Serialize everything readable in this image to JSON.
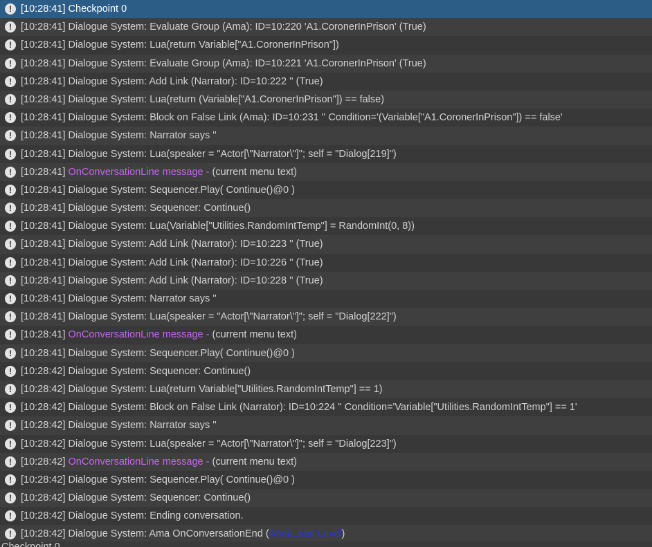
{
  "console": {
    "entries": [
      {
        "time": "[10:28:41]",
        "text": "Checkpoint 0",
        "selected": true
      },
      {
        "time": "[10:28:41]",
        "text": "Dialogue System: Evaluate Group (Ama): ID=10:220 'A1.CoronerInPrison' (True)"
      },
      {
        "time": "[10:28:41]",
        "text": "Dialogue System: Lua(return Variable[\"A1.CoronerInPrison\"])"
      },
      {
        "time": "[10:28:41]",
        "text": "Dialogue System: Evaluate Group (Ama): ID=10:221 'A1.CoronerInPrison' (True)"
      },
      {
        "time": "[10:28:41]",
        "text": "Dialogue System: Add Link (Narrator): ID=10:222 '' (True)"
      },
      {
        "time": "[10:28:41]",
        "text": "Dialogue System: Lua(return (Variable[\"A1.CoronerInPrison\"]) == false)"
      },
      {
        "time": "[10:28:41]",
        "text": "Dialogue System: Block on False Link (Ama): ID=10:231 '' Condition='(Variable[\"A1.CoronerInPrison\"]) == false'"
      },
      {
        "time": "[10:28:41]",
        "text": "Dialogue System: Narrator says ''"
      },
      {
        "time": "[10:28:41]",
        "text": "Dialogue System: Lua(speaker = \"Actor[\\\"Narrator\\\"]\"; self = \"Dialog[219]\")"
      },
      {
        "time": "[10:28:41]",
        "highlight": "OnConversationLine message - ",
        "text": " (current menu text)"
      },
      {
        "time": "[10:28:41]",
        "text": "Dialogue System: Sequencer.Play( Continue()@0 )"
      },
      {
        "time": "[10:28:41]",
        "text": "Dialogue System: Sequencer: Continue()"
      },
      {
        "time": "[10:28:41]",
        "text": "Dialogue System: Lua(Variable[\"Utilities.RandomIntTemp\"] = RandomInt(0, 8))"
      },
      {
        "time": "[10:28:41]",
        "text": "Dialogue System: Add Link (Narrator): ID=10:223 '' (True)"
      },
      {
        "time": "[10:28:41]",
        "text": "Dialogue System: Add Link (Narrator): ID=10:226 '' (True)"
      },
      {
        "time": "[10:28:41]",
        "text": "Dialogue System: Add Link (Narrator): ID=10:228 '' (True)"
      },
      {
        "time": "[10:28:41]",
        "text": "Dialogue System: Narrator says ''"
      },
      {
        "time": "[10:28:41]",
        "text": "Dialogue System: Lua(speaker = \"Actor[\\\"Narrator\\\"]\"; self = \"Dialog[222]\")"
      },
      {
        "time": "[10:28:41]",
        "highlight": "OnConversationLine message - ",
        "text": " (current menu text)"
      },
      {
        "time": "[10:28:41]",
        "text": "Dialogue System: Sequencer.Play( Continue()@0 )"
      },
      {
        "time": "[10:28:42]",
        "text": "Dialogue System: Sequencer: Continue()"
      },
      {
        "time": "[10:28:42]",
        "text": "Dialogue System: Lua(return Variable[\"Utilities.RandomIntTemp\"] == 1)"
      },
      {
        "time": "[10:28:42]",
        "text": "Dialogue System: Block on False Link (Narrator): ID=10:224 '' Condition='Variable[\"Utilities.RandomIntTemp\"] == 1'"
      },
      {
        "time": "[10:28:42]",
        "text": "Dialogue System: Narrator says ''"
      },
      {
        "time": "[10:28:42]",
        "text": "Dialogue System: Lua(speaker = \"Actor[\\\"Narrator\\\"]\"; self = \"Dialog[223]\")"
      },
      {
        "time": "[10:28:42]",
        "highlight": "OnConversationLine message - ",
        "text": " (current menu text)"
      },
      {
        "time": "[10:28:42]",
        "text": "Dialogue System: Sequencer.Play( Continue()@0 )"
      },
      {
        "time": "[10:28:42]",
        "text": "Dialogue System: Sequencer: Continue()"
      },
      {
        "time": "[10:28:42]",
        "text": "Dialogue System: Ending conversation."
      },
      {
        "time": "[10:28:42]",
        "text": "Dialogue System: Ama OnConversationEnd (",
        "link": "Ama/Load Level",
        "suffix": ")"
      }
    ],
    "tail_text": "Checkpoint 0",
    "icon_name": "info-exclamation-icon",
    "icon_glyph": "!",
    "colors": {
      "selected": "#2c5d87",
      "highlight": "#c764f2",
      "link": "#2b35e0"
    }
  }
}
